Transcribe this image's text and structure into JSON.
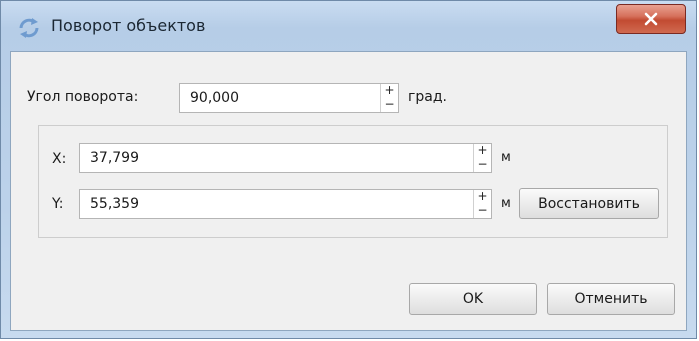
{
  "window": {
    "title": "Поворот объектов",
    "close_label": "x"
  },
  "rotation": {
    "label": "Угол поворота:",
    "value": "90,000",
    "unit": "град."
  },
  "x": {
    "label": "X:",
    "value": "37,799",
    "unit": "м"
  },
  "y": {
    "label": "Y:",
    "value": "55,359",
    "unit": "м"
  },
  "spin": {
    "up": "+",
    "down": "−"
  },
  "buttons": {
    "restore": "Восстановить",
    "ok": "OK",
    "cancel": "Отменить"
  },
  "colors": {
    "titlebar": "#bcd2ea",
    "close": "#c24b32",
    "dialog_bg": "#f0f0f0"
  }
}
